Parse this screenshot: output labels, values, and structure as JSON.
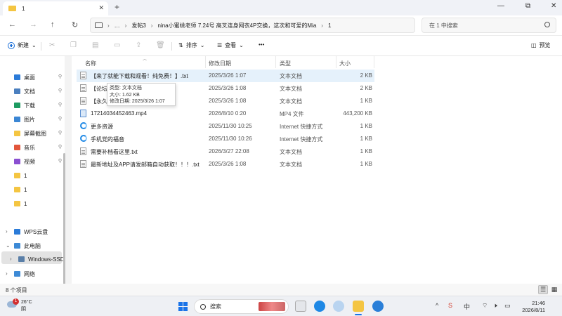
{
  "window": {
    "tab_title": "1",
    "tab_close": "✕",
    "new_tab": "+",
    "controls": {
      "minimize": "—",
      "maximize": "⧉",
      "close": "✕"
    }
  },
  "nav": {
    "back": "←",
    "forward": "→",
    "up": "↑",
    "refresh": "↻",
    "breadcrumb": [
      "…",
      "发帖3",
      "nina小蜜桃老师 7.24号 高叉连身网衣4P交换，这次和可爱的Mia",
      "1"
    ],
    "breadcrumb_sep": "›",
    "search_placeholder": "在 1 中搜索"
  },
  "toolbar": {
    "new_label": "新建",
    "sort_label": "排序",
    "view_label": "查看",
    "more_label": "•••",
    "preview_label": "预览",
    "dropdown": "⌄"
  },
  "sidebar": {
    "pinned": [
      {
        "label": "桌面",
        "icon": "desktop-icon",
        "color": "#2b7bd8"
      },
      {
        "label": "文档",
        "icon": "documents-icon",
        "color": "#4a7fbf"
      },
      {
        "label": "下载",
        "icon": "downloads-icon",
        "color": "#1e9b61"
      },
      {
        "label": "图片",
        "icon": "pictures-icon",
        "color": "#3a86d4"
      },
      {
        "label": "屏幕截图",
        "icon": "folder-icon",
        "color": "#f4c542"
      },
      {
        "label": "音乐",
        "icon": "music-icon",
        "color": "#e2563b"
      },
      {
        "label": "视频",
        "icon": "videos-icon",
        "color": "#8a4fd1"
      },
      {
        "label": "1",
        "icon": "folder-icon",
        "color": "#f4c542"
      },
      {
        "label": "1",
        "icon": "folder-icon",
        "color": "#f4c542"
      },
      {
        "label": "1",
        "icon": "folder-icon",
        "color": "#f4c542"
      }
    ],
    "tree": [
      {
        "label": "WPS云盘",
        "icon": "cloud-icon",
        "color": "#2b7bd8"
      },
      {
        "label": "此电脑",
        "icon": "computer-icon",
        "color": "#3d8ad6"
      },
      {
        "label": "Windows-SSD",
        "icon": "drive-icon",
        "color": "#5a7fa8"
      },
      {
        "label": "网络",
        "icon": "network-icon",
        "color": "#3d8ad6"
      }
    ],
    "pin_glyph": "📌"
  },
  "columns": {
    "name": "名称",
    "date": "修改日期",
    "type": "类型",
    "size": "大小"
  },
  "files": [
    {
      "name": "【来了就能下载和观看！纯免费！】.txt",
      "date": "2025/3/26 1:07",
      "type": "文本文档",
      "size": "2 KB",
      "icon": "text-file-icon"
    },
    {
      "name": "【论坛介",
      "date": "2025/3/26 1:08",
      "type": "文本文档",
      "size": "2 KB",
      "icon": "text-file-icon"
    },
    {
      "name": "【永久地",
      "date": "2025/3/26 1:08",
      "type": "文本文档",
      "size": "1 KB",
      "icon": "text-file-icon"
    },
    {
      "name": "17214034452463.mp4",
      "date": "2026/8/10 0:20",
      "type": "MP4 文件",
      "size": "443,200 KB",
      "icon": "video-file-icon"
    },
    {
      "name": "更多资源",
      "date": "2025/11/30 10:25",
      "type": "Internet 快捷方式",
      "size": "1 KB",
      "icon": "internet-shortcut-icon"
    },
    {
      "name": "手机党的福音",
      "date": "2025/11/30 10:26",
      "type": "Internet 快捷方式",
      "size": "1 KB",
      "icon": "internet-shortcut-icon"
    },
    {
      "name": "需要补档看这里.txt",
      "date": "2026/3/27 22:08",
      "type": "文本文档",
      "size": "1 KB",
      "icon": "text-file-icon"
    },
    {
      "name": "最新地址及APP请发邮箱自动获取！！！.txt",
      "date": "2025/3/26 1:08",
      "type": "文本文档",
      "size": "1 KB",
      "icon": "text-file-icon"
    }
  ],
  "tooltip": {
    "type_line": "类型: 文本文档",
    "size_line": "大小: 1.62 KB",
    "date_line": "修改日期: 2025/3/26 1:07"
  },
  "status": {
    "count": "8 个项目"
  },
  "taskbar": {
    "weather_temp": "26°C",
    "weather_desc": "阴",
    "weather_badge": "1",
    "search_label": "搜索",
    "time": "21:46",
    "date": "2026/8/11",
    "tray": {
      "chevron": "^",
      "ime": "中"
    }
  }
}
